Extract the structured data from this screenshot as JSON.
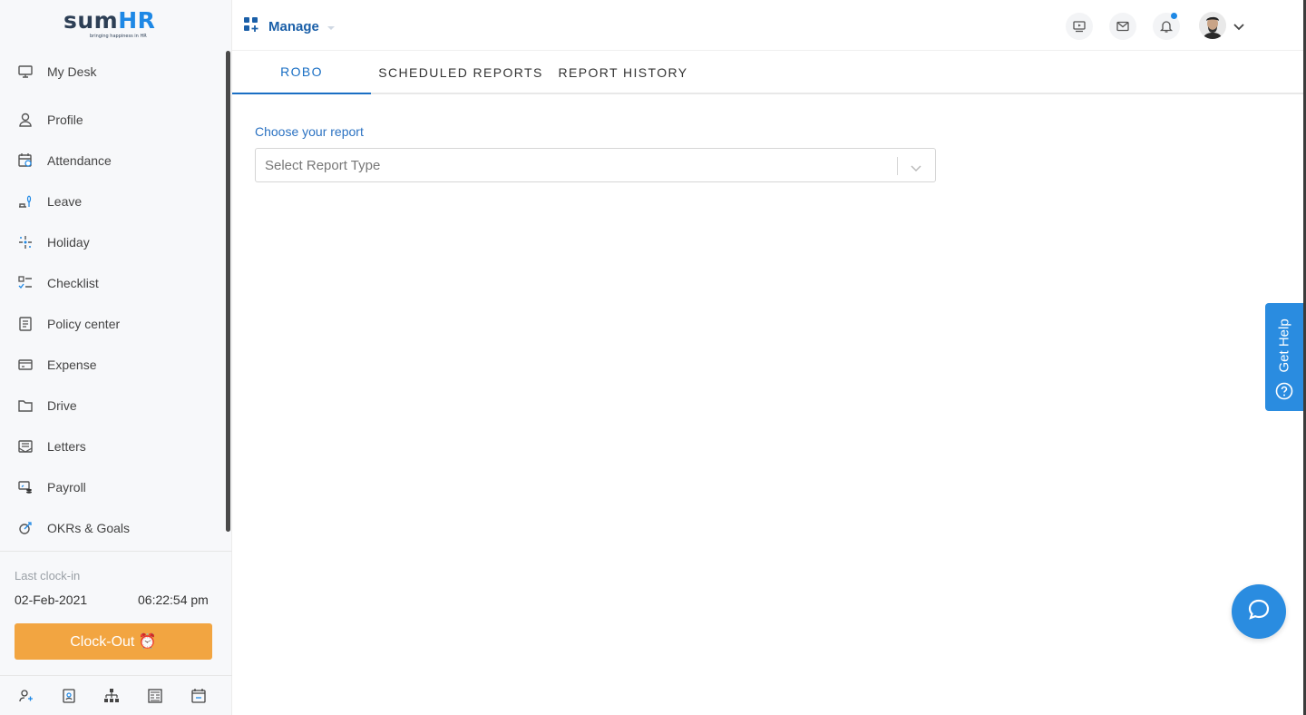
{
  "brand": {
    "logo_sum": "sum",
    "logo_hr": "HR",
    "tagline": "bringing happiness in HR"
  },
  "header": {
    "manage_label": "Manage",
    "icons": [
      "video-icon",
      "mail-icon",
      "bell-icon",
      "avatar"
    ]
  },
  "sidebar": {
    "items": [
      {
        "label": "My Desk",
        "icon": "monitor-icon"
      },
      {
        "label": "Profile",
        "icon": "user-icon"
      },
      {
        "label": "Attendance",
        "icon": "calendar-clock-icon"
      },
      {
        "label": "Leave",
        "icon": "leave-icon"
      },
      {
        "label": "Holiday",
        "icon": "sparkle-icon"
      },
      {
        "label": "Checklist",
        "icon": "checklist-icon"
      },
      {
        "label": "Policy center",
        "icon": "document-icon"
      },
      {
        "label": "Expense",
        "icon": "card-icon"
      },
      {
        "label": "Drive",
        "icon": "folder-icon"
      },
      {
        "label": "Letters",
        "icon": "letters-icon"
      },
      {
        "label": "Payroll",
        "icon": "payroll-icon"
      },
      {
        "label": "OKRs & Goals",
        "icon": "goals-icon"
      }
    ],
    "clock": {
      "label": "Last clock-in",
      "date": "02-Feb-2021",
      "time": "06:22:54 pm",
      "button_label": "Clock-Out ⏰"
    }
  },
  "tabs": [
    {
      "label": "ROBO",
      "active": true
    },
    {
      "label": "SCHEDULED REPORTS",
      "active": false
    },
    {
      "label": "REPORT HISTORY",
      "active": false
    }
  ],
  "report": {
    "label": "Choose your report",
    "placeholder": "Select Report Type"
  },
  "help": {
    "label": "Get Help"
  },
  "colors": {
    "accent": "#1a6fc4",
    "clock_button": "#f2a541",
    "help": "#2a8ce0"
  }
}
